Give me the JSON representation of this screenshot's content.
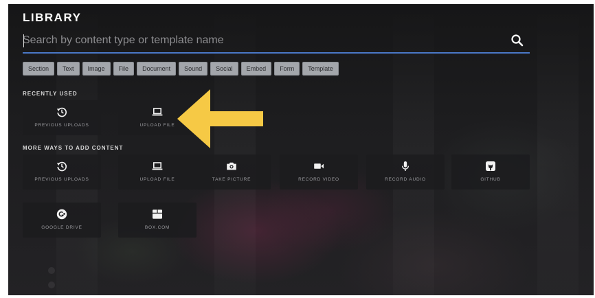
{
  "library": {
    "title": "LIBRARY",
    "search": {
      "value": "",
      "placeholder": "Search by content type or template name",
      "icon": "search-icon"
    },
    "filters": [
      "Section",
      "Text",
      "Image",
      "File",
      "Document",
      "Sound",
      "Social",
      "Embed",
      "Form",
      "Template"
    ],
    "recently_used": {
      "label": "RECENTLY USED",
      "items": [
        {
          "label": "PREVIOUS UPLOADS",
          "icon": "history-icon"
        },
        {
          "label": "UPLOAD FILE",
          "icon": "laptop-icon"
        }
      ]
    },
    "more_ways": {
      "label": "MORE WAYS TO ADD CONTENT",
      "items": [
        {
          "label": "PREVIOUS UPLOADS",
          "icon": "history-icon"
        },
        {
          "label": "UPLOAD FILE",
          "icon": "laptop-icon"
        },
        {
          "label": "TAKE PICTURE",
          "icon": "camera-icon"
        },
        {
          "label": "RECORD VIDEO",
          "icon": "video-camera-icon"
        },
        {
          "label": "RECORD AUDIO",
          "icon": "microphone-icon"
        },
        {
          "label": "GITHUB",
          "icon": "github-icon"
        },
        {
          "label": "GOOGLE DRIVE",
          "icon": "google-drive-icon"
        },
        {
          "label": "BOX.COM",
          "icon": "box-icon"
        }
      ]
    }
  },
  "annotation": {
    "arrow_color": "#f6c945",
    "icon": "pointer-arrow-icon"
  },
  "colors": {
    "search_underline": "#4a78c7",
    "chip_background": "#a3a6ab",
    "tile_background": "#1c1c1e"
  }
}
